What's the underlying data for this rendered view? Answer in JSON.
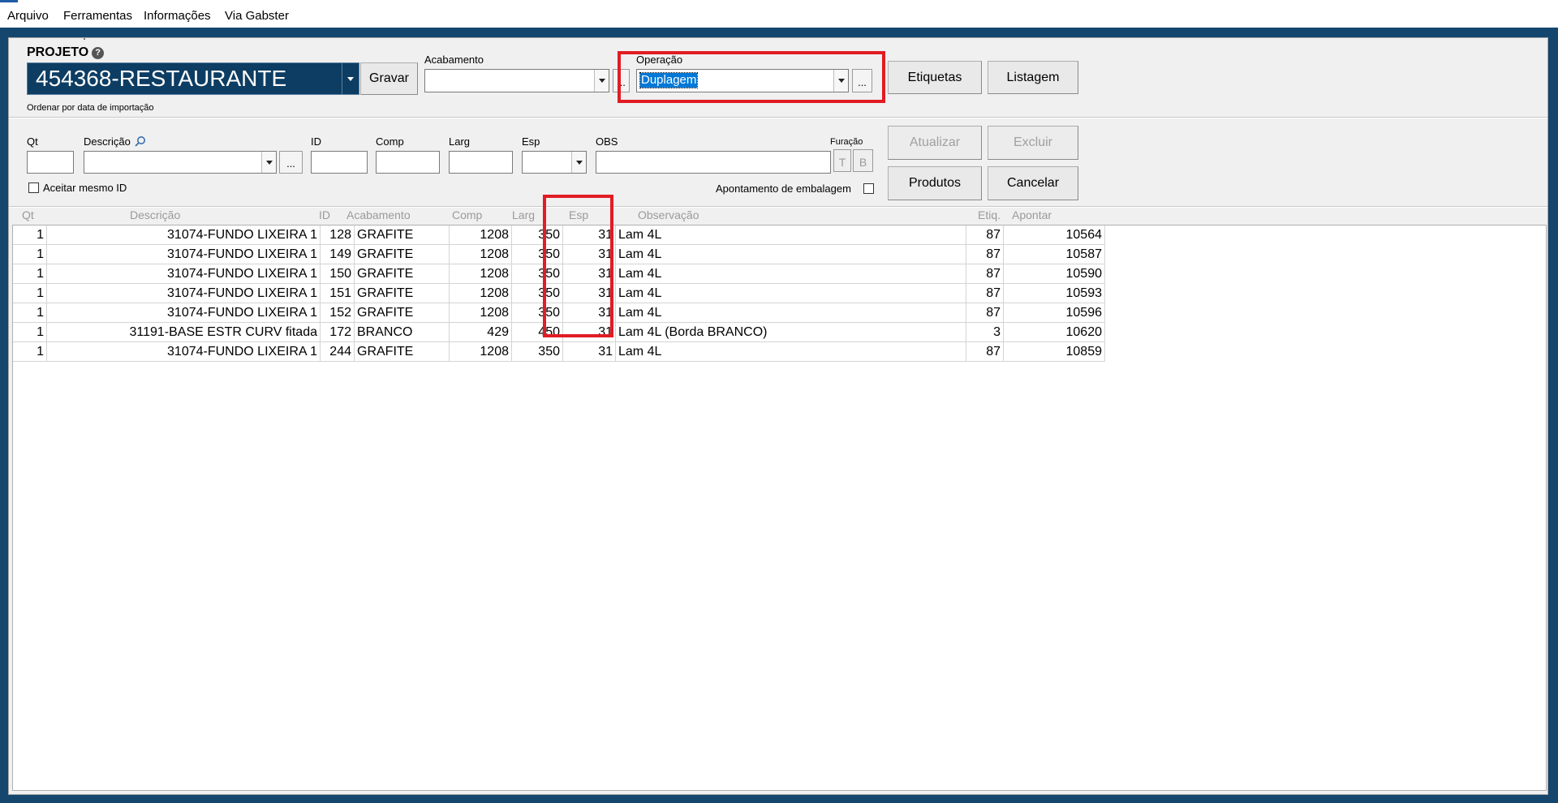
{
  "menu": [
    "Arquivo",
    "Ferramentas",
    "Informações",
    "Via Gabster"
  ],
  "header": {
    "projeto_label": "PROJETO",
    "projeto_value": "454368-RESTAURANTE",
    "gravar_label": "Gravar",
    "ordenar_text": "Ordenar por data de importação",
    "acabamento_label": "Acabamento",
    "acabamento_value": "",
    "dots": "...",
    "operacao_label": "Operação",
    "operacao_value": "Duplagem",
    "etiquetas_label": "Etiquetas",
    "listagem_label": "Listagem"
  },
  "form": {
    "qt_label": "Qt",
    "descricao_label": "Descrição",
    "id_label": "ID",
    "comp_label": "Comp",
    "larg_label": "Larg",
    "esp_label": "Esp",
    "obs_label": "OBS",
    "furacao_label": "Furação",
    "furacao_btn1": "T",
    "furacao_btn2": "B",
    "aceitar_label": "Aceitar mesmo ID",
    "apontamento_label": "Apontamento de embalagem",
    "atualizar_label": "Atualizar",
    "excluir_label": "Excluir",
    "produtos_label": "Produtos",
    "cancelar_label": "Cancelar"
  },
  "table": {
    "headers": {
      "qt": "Qt",
      "descricao": "Descrição",
      "id": "ID",
      "acabamento": "Acabamento",
      "comp": "Comp",
      "larg": "Larg",
      "esp": "Esp",
      "observacao": "Observação",
      "etiq": "Etiq.",
      "apontar": "Apontar"
    },
    "rows": [
      {
        "qt": "1",
        "descricao": "31074-FUNDO LIXEIRA 1",
        "id": "128",
        "acabamento": "GRAFITE",
        "comp": "1208",
        "larg": "350",
        "esp": "31",
        "observacao": "Lam 4L",
        "etiq": "87",
        "apontar": "10564"
      },
      {
        "qt": "1",
        "descricao": "31074-FUNDO LIXEIRA 1",
        "id": "149",
        "acabamento": "GRAFITE",
        "comp": "1208",
        "larg": "350",
        "esp": "31",
        "observacao": "Lam 4L",
        "etiq": "87",
        "apontar": "10587"
      },
      {
        "qt": "1",
        "descricao": "31074-FUNDO LIXEIRA 1",
        "id": "150",
        "acabamento": "GRAFITE",
        "comp": "1208",
        "larg": "350",
        "esp": "31",
        "observacao": "Lam 4L",
        "etiq": "87",
        "apontar": "10590"
      },
      {
        "qt": "1",
        "descricao": "31074-FUNDO LIXEIRA 1",
        "id": "151",
        "acabamento": "GRAFITE",
        "comp": "1208",
        "larg": "350",
        "esp": "31",
        "observacao": "Lam 4L",
        "etiq": "87",
        "apontar": "10593"
      },
      {
        "qt": "1",
        "descricao": "31074-FUNDO LIXEIRA 1",
        "id": "152",
        "acabamento": "GRAFITE",
        "comp": "1208",
        "larg": "350",
        "esp": "31",
        "observacao": "Lam 4L",
        "etiq": "87",
        "apontar": "10596"
      },
      {
        "qt": "1",
        "descricao": "31191-BASE ESTR CURV fitada",
        "id": "172",
        "acabamento": "BRANCO",
        "comp": "429",
        "larg": "450",
        "esp": "31",
        "observacao": "Lam 4L (Borda BRANCO)",
        "etiq": "3",
        "apontar": "10620"
      },
      {
        "qt": "1",
        "descricao": "31074-FUNDO LIXEIRA 1",
        "id": "244",
        "acabamento": "GRAFITE",
        "comp": "1208",
        "larg": "350",
        "esp": "31",
        "observacao": "Lam 4L",
        "etiq": "87",
        "apontar": "10859"
      }
    ]
  },
  "colors": {
    "frame": "#14466e",
    "projeto_bg": "#0d3d63",
    "highlight": "#e11c24",
    "selection": "#0078d7"
  }
}
